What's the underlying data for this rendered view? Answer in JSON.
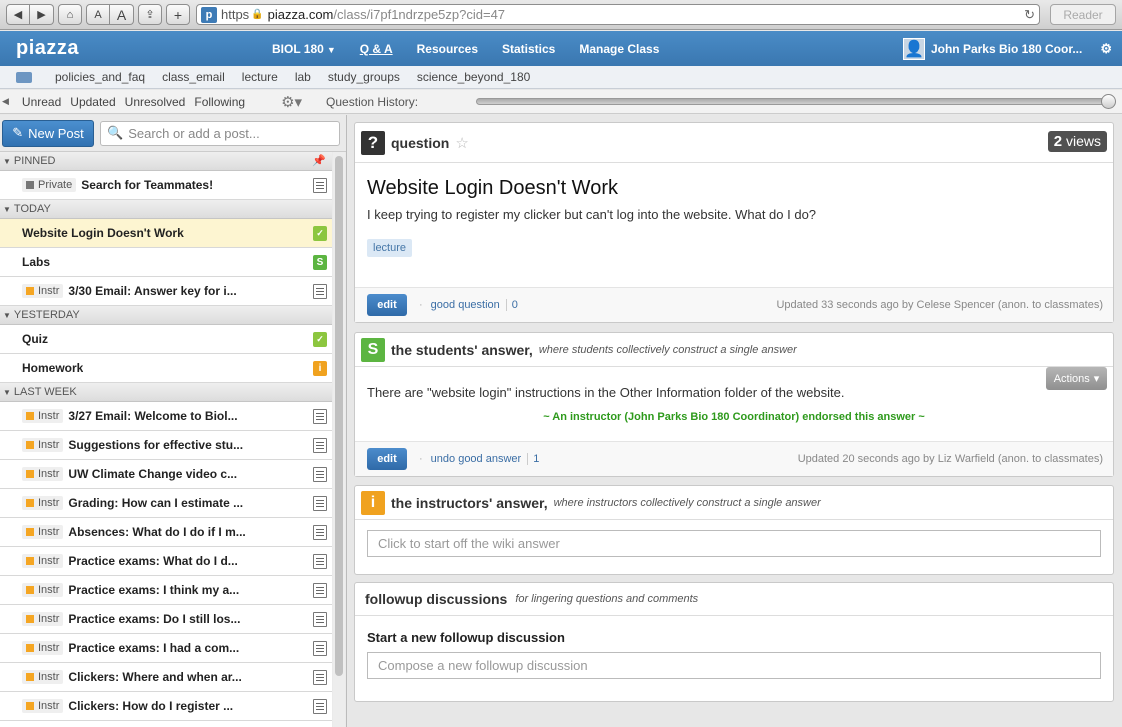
{
  "browser": {
    "url_protocol": "https",
    "url_domain": "piazza.com",
    "url_path": "/class/i7pf1ndrzpe5zp?cid=47",
    "reader_label": "Reader",
    "font_small": "A",
    "font_large": "A",
    "add_label": "+"
  },
  "nav": {
    "logo": "piazza",
    "items": [
      {
        "label": "BIOL 180",
        "caret": "▼"
      },
      {
        "label": "Q & A"
      },
      {
        "label": "Resources"
      },
      {
        "label": "Statistics"
      },
      {
        "label": "Manage Class"
      }
    ],
    "user_name": "John Parks Bio 180 Coor..."
  },
  "folders": [
    "policies_and_faq",
    "class_email",
    "lecture",
    "lab",
    "study_groups",
    "science_beyond_180"
  ],
  "filters": {
    "items": [
      "Unread",
      "Updated",
      "Unresolved",
      "Following"
    ],
    "question_history_label": "Question History:",
    "question_history_position": 1.0
  },
  "left": {
    "new_post_label": "New Post",
    "search_placeholder": "Search or add a post...",
    "groups": [
      {
        "label": "PINNED",
        "posts": [
          {
            "tag": "Private",
            "title": "Search for Teammates!",
            "icon": "list-icon"
          }
        ]
      },
      {
        "label": "TODAY",
        "posts": [
          {
            "tag": "",
            "title": "Website Login Doesn't Work",
            "icon": "check-icon",
            "selected": true
          },
          {
            "tag": "",
            "title": "Labs",
            "icon": "s-icon"
          },
          {
            "tag": "Instr",
            "title": "3/30 Email: Answer key for i...",
            "icon": "list-icon"
          }
        ]
      },
      {
        "label": "YESTERDAY",
        "posts": [
          {
            "tag": "",
            "title": "Quiz",
            "icon": "check-icon"
          },
          {
            "tag": "",
            "title": "Homework",
            "icon": "i-icon"
          }
        ]
      },
      {
        "label": "LAST WEEK",
        "posts": [
          {
            "tag": "Instr",
            "title": "3/27 Email: Welcome to Biol...",
            "icon": "list-icon"
          },
          {
            "tag": "Instr",
            "title": "Suggestions for effective stu...",
            "icon": "list-icon"
          },
          {
            "tag": "Instr",
            "title": "UW Climate Change video c...",
            "icon": "list-icon"
          },
          {
            "tag": "Instr",
            "title": "Grading: How can I estimate ...",
            "icon": "list-icon"
          },
          {
            "tag": "Instr",
            "title": "Absences: What do I do if I m...",
            "icon": "list-icon"
          },
          {
            "tag": "Instr",
            "title": "Practice exams: What do I d...",
            "icon": "list-icon"
          },
          {
            "tag": "Instr",
            "title": "Practice exams: I think my a...",
            "icon": "list-icon"
          },
          {
            "tag": "Instr",
            "title": "Practice exams: Do I still los...",
            "icon": "list-icon"
          },
          {
            "tag": "Instr",
            "title": "Practice exams: I had a com...",
            "icon": "list-icon"
          },
          {
            "tag": "Instr",
            "title": "Clickers: Where and when ar...",
            "icon": "list-icon"
          },
          {
            "tag": "Instr",
            "title": "Clickers: How do I register ...",
            "icon": "list-icon"
          }
        ]
      }
    ]
  },
  "question": {
    "header": "question",
    "views_count": "2",
    "views_label": "views",
    "title": "Website Login Doesn't Work",
    "body": "I keep trying to register my clicker but can't log into the website. What do I do?",
    "folder_tag": "lecture",
    "edit_label": "edit",
    "good_label": "good question",
    "good_count": "0",
    "updated": "Updated 33 seconds ago by Celese Spencer (anon. to classmates)"
  },
  "student_answer": {
    "icon_letter": "S",
    "header": "the students' answer,",
    "subheader": "where students collectively construct a single answer",
    "actions_label": "Actions",
    "body": "There are \"website login\" instructions in the Other Information folder of the website.",
    "endorse": "~ An instructor (John Parks Bio 180 Coordinator) endorsed this answer ~",
    "edit_label": "edit",
    "good_label": "undo good answer",
    "good_count": "1",
    "updated": "Updated 20 seconds ago by Liz Warfield (anon. to classmates)"
  },
  "instructor_answer": {
    "icon_letter": "i",
    "header": "the instructors' answer,",
    "subheader": "where instructors collectively construct a single answer",
    "placeholder": "Click to start off the wiki answer"
  },
  "followup": {
    "header": "followup discussions",
    "subheader": "for lingering questions and comments",
    "start_label": "Start a new followup discussion",
    "placeholder": "Compose a new followup discussion"
  },
  "colors": {
    "nav_blue": "#3a77b0",
    "selected_row": "#fdf5d1",
    "instr_orange": "#f5a623",
    "student_green": "#5cb541",
    "endorse_green": "#2e9a1c"
  }
}
